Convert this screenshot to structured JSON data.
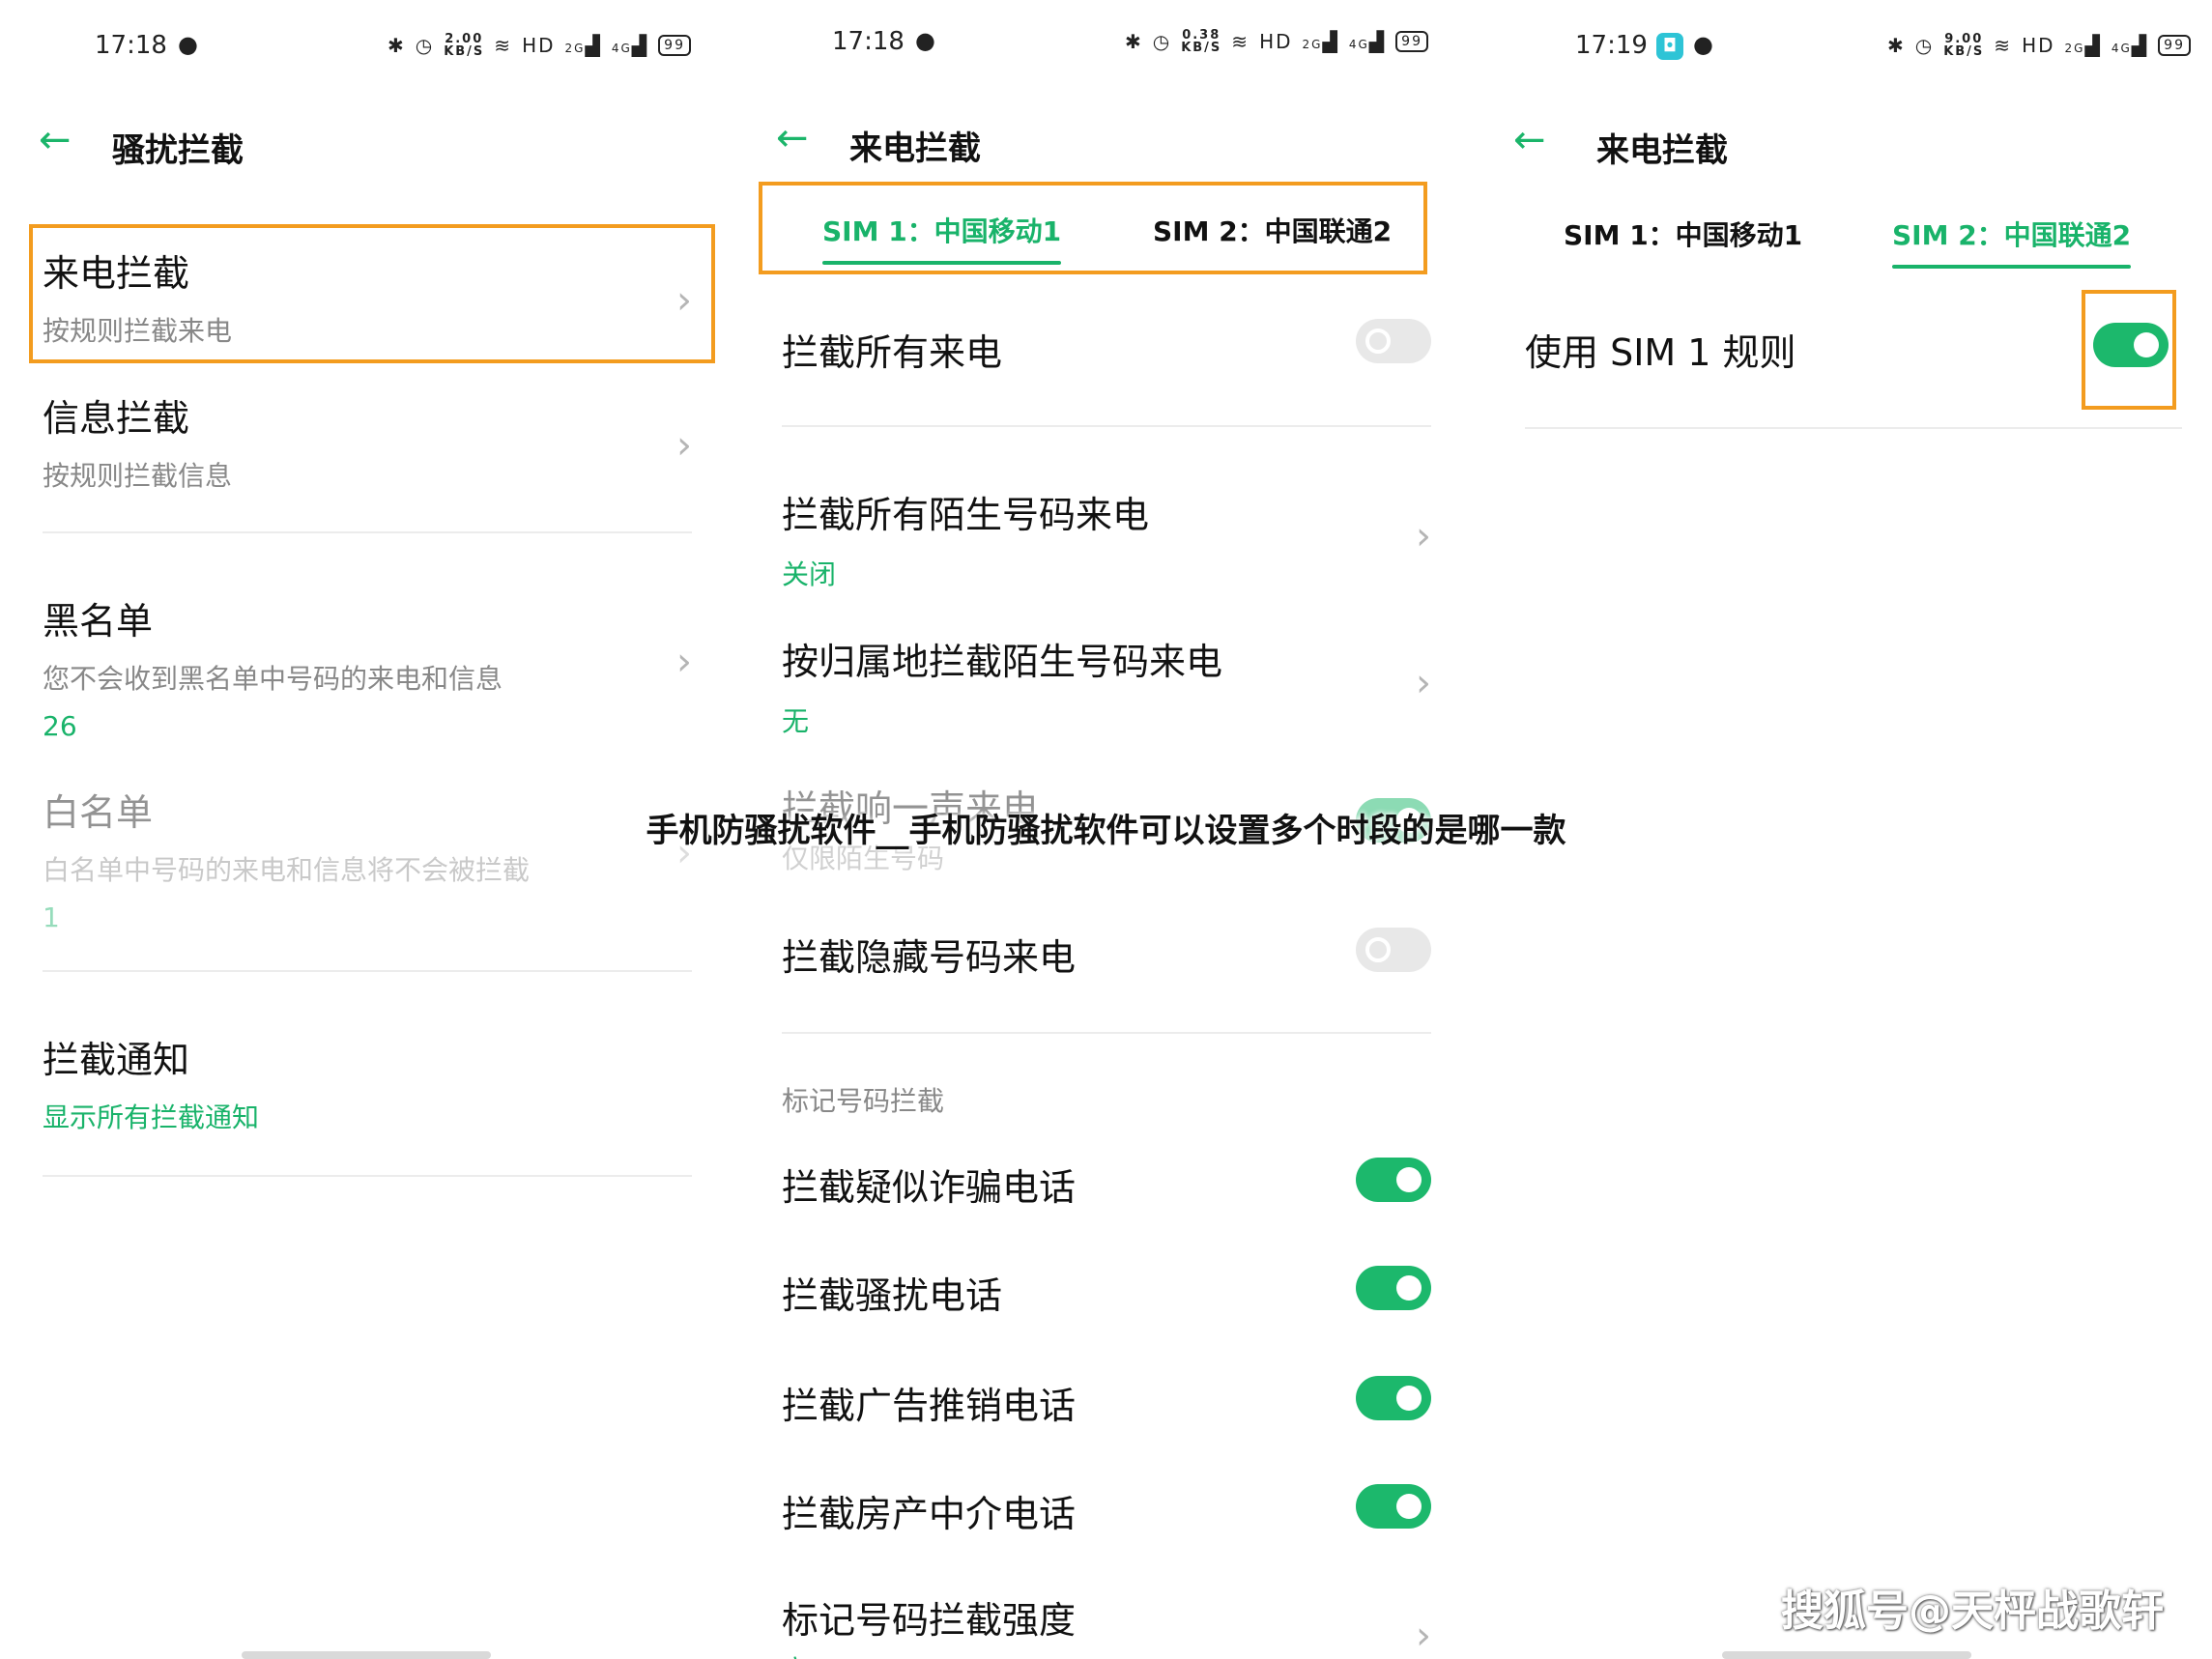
{
  "panel1": {
    "status": {
      "time": "17:18",
      "speed": "2.00",
      "speed_unit": "KB/S",
      "hd": "HD",
      "net1": "2G",
      "net2": "4G",
      "battery": "99"
    },
    "header": {
      "back": "←",
      "title": "骚扰拦截"
    },
    "items": [
      {
        "title": "来电拦截",
        "subtitle": "按规则拦截来电"
      },
      {
        "title": "信息拦截",
        "subtitle": "按规则拦截信息"
      },
      {
        "title": "黑名单",
        "subtitle": "您不会收到黑名单中号码的来电和信息",
        "count": "26"
      },
      {
        "title": "白名单",
        "subtitle": "白名单中号码的来电和信息将不会被拦截",
        "count": "1"
      },
      {
        "title": "拦截通知",
        "value": "显示所有拦截通知"
      }
    ]
  },
  "panel2": {
    "status": {
      "time": "17:18",
      "speed": "0.38",
      "speed_unit": "KB/S",
      "hd": "HD",
      "net1": "2G",
      "net2": "4G",
      "battery": "99"
    },
    "header": {
      "back": "←",
      "title": "来电拦截"
    },
    "tabs": [
      "SIM 1：中国移动1",
      "SIM 2：中国联通2"
    ],
    "rows": [
      {
        "title": "拦截所有来电"
      },
      {
        "title": "拦截所有陌生号码来电",
        "value": "关闭"
      },
      {
        "title": "按归属地拦截陌生号码来电",
        "value": "无"
      },
      {
        "title": "拦截响一声来电",
        "subtitle": "仅限陌生号码"
      },
      {
        "title": "拦截隐藏号码来电"
      }
    ],
    "section": "标记号码拦截",
    "marked": [
      {
        "title": "拦截疑似诈骗电话"
      },
      {
        "title": "拦截骚扰电话"
      },
      {
        "title": "拦截广告推销电话"
      },
      {
        "title": "拦截房产中介电话"
      },
      {
        "title": "标记号码拦截强度",
        "value": "高"
      }
    ]
  },
  "panel3": {
    "status": {
      "time": "17:19",
      "speed": "9.00",
      "speed_unit": "KB/S",
      "hd": "HD",
      "net1": "2G",
      "net2": "4G",
      "battery": "99"
    },
    "header": {
      "back": "←",
      "title": "来电拦截"
    },
    "tabs": [
      "SIM 1：中国移动1",
      "SIM 2：中国联通2"
    ],
    "row": {
      "title": "使用 SIM 1 规则"
    }
  },
  "overlay_title": "手机防骚扰软件__手机防骚扰软件可以设置多个时段的是哪一款",
  "watermark": "搜狐号@天枰战歌轩",
  "colors": {
    "accent": "#1cb86c",
    "highlight": "#f39c1f",
    "toggle_off": "#e8e8e8"
  }
}
